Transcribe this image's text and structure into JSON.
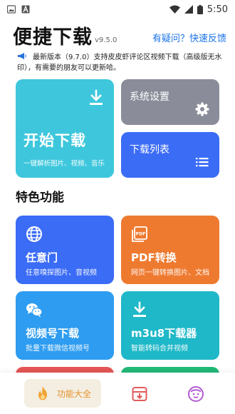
{
  "status_bar": {
    "time": "5:50"
  },
  "header": {
    "title": "便捷下载",
    "version": "v9.5.0",
    "feedback_link": "有疑问？快速反馈"
  },
  "notice": {
    "text": "最新版本（9.7.0）支持皮皮虾评论区视频下载（高级版无水印），有需要的朋友可以更新哈。"
  },
  "main_actions": {
    "start": {
      "label": "开始下载",
      "subtitle": "一键解析图片、视频、音乐"
    },
    "settings": {
      "label": "系统设置"
    },
    "download_list": {
      "label": "下载列表"
    }
  },
  "features": {
    "title": "特色功能",
    "items": [
      {
        "title": "任意门",
        "subtitle": "任意嗅探图片、音视频",
        "icon": "globe-icon",
        "color": "#3b6cf6"
      },
      {
        "title": "PDF转换",
        "subtitle": "网页一键转换图片、文档",
        "icon": "pdf-icon",
        "color": "#ee7a30"
      },
      {
        "title": "视频号下载",
        "subtitle": "批量下载微信视频号",
        "icon": "wechat-icon",
        "color": "#2e9cf0"
      },
      {
        "title": "m3u8下载器",
        "subtitle": "智能转码合并视频",
        "icon": "download-icon",
        "color": "#1fb8c8"
      }
    ]
  },
  "bottom_nav": {
    "active_label": "功能大全",
    "accent": "#e4912a"
  }
}
